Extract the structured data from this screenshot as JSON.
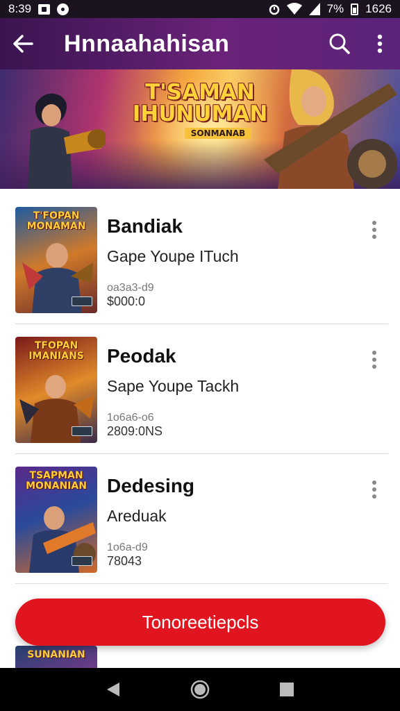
{
  "status_bar": {
    "time": "8:39",
    "battery": "7%",
    "clock_right": "1626",
    "icons": [
      "notification-box-icon",
      "notification-circle-icon",
      "alarm-icon",
      "wifi-icon",
      "signal-icon",
      "battery-icon"
    ]
  },
  "app_bar": {
    "title": "Hnnaahahisan",
    "icons": [
      "back-arrow-icon",
      "search-icon",
      "more-vert-icon"
    ]
  },
  "banner": {
    "title_line1": "T'SAMAN",
    "title_line2": "IHUNUMAN",
    "tagline": "SONMANAB",
    "active_dot": 1
  },
  "items": [
    {
      "thumb_title": "T'FOPAN MONAMAN",
      "title": "Bandiak",
      "subtitle": "Gape Youpe ITuch",
      "meta1": "oa3a3-d9",
      "meta2": "$000:0"
    },
    {
      "thumb_title": "TFOPAN IMANIANS",
      "title": "Peodak",
      "subtitle": "Sape Youpe Tackh",
      "meta1": "1o6a6-o6",
      "meta2": "2809:0NS"
    },
    {
      "thumb_title": "TSAPMAN MONANIAN",
      "title": "Dedesing",
      "subtitle": "Areduak",
      "meta1": "1o6a-d9",
      "meta2": "78043"
    }
  ],
  "partial_thumb_title": "SUNANIAN",
  "cta_label": "Tonoreetiepcls",
  "colors": {
    "app_bar": "#5b237a",
    "cta": "#e0151f",
    "active_dot": "#4aa3d8"
  }
}
